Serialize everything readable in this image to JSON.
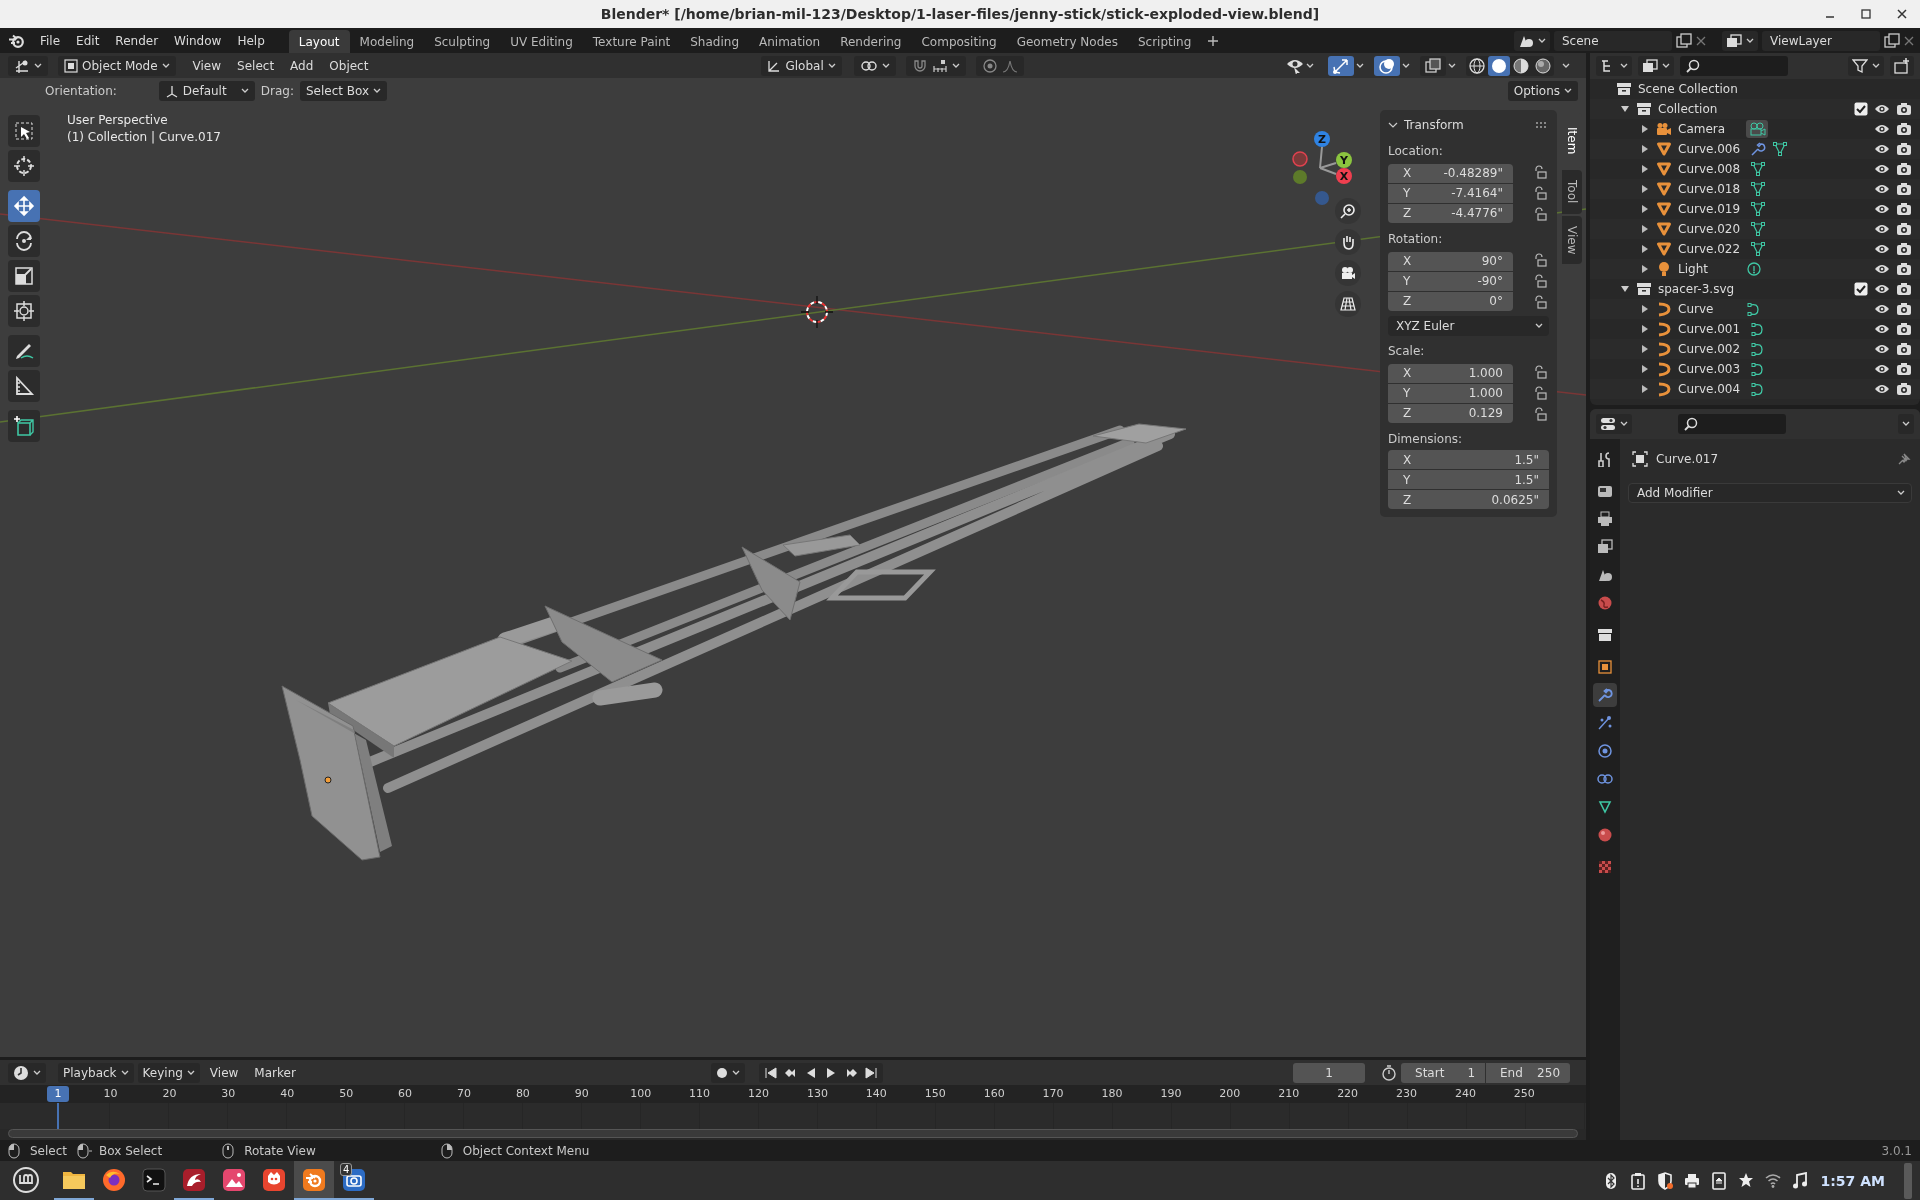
{
  "window": {
    "title": "Blender* [/home/brian-mil-123/Desktop/1-laser-files/jenny-stick/stick-exploded-view.blend]"
  },
  "menu": [
    "File",
    "Edit",
    "Render",
    "Window",
    "Help"
  ],
  "workspaces": [
    {
      "label": "Layout",
      "selected": true
    },
    {
      "label": "Modeling",
      "selected": false
    },
    {
      "label": "Sculpting",
      "selected": false
    },
    {
      "label": "UV Editing",
      "selected": false
    },
    {
      "label": "Texture Paint",
      "selected": false
    },
    {
      "label": "Shading",
      "selected": false
    },
    {
      "label": "Animation",
      "selected": false
    },
    {
      "label": "Rendering",
      "selected": false
    },
    {
      "label": "Compositing",
      "selected": false
    },
    {
      "label": "Geometry Nodes",
      "selected": false
    },
    {
      "label": "Scripting",
      "selected": false
    }
  ],
  "scene": "Scene",
  "view_layer": "ViewLayer",
  "viewport": {
    "mode": "Object Mode",
    "menus": [
      "View",
      "Select",
      "Add",
      "Object"
    ],
    "orientation_global": "Global",
    "toggles": [
      {
        "kind": "gizmos",
        "on": true
      },
      {
        "kind": "overlays",
        "on": true
      },
      {
        "kind": "xray",
        "on": false
      }
    ],
    "shading": [
      {
        "kind": "wireframe",
        "selected": false
      },
      {
        "kind": "solid",
        "selected": true
      },
      {
        "kind": "material",
        "selected": false
      },
      {
        "kind": "rendered",
        "selected": false
      }
    ],
    "tool_settings": {
      "orientation_label": "Orientation:",
      "orientation": "Default",
      "drag_label": "Drag:",
      "drag": "Select Box",
      "options": "Options"
    },
    "tool_groups": [
      [
        {
          "kind": "select_box",
          "selected": false
        },
        {
          "kind": "cursor",
          "selected": false
        }
      ],
      [
        {
          "kind": "move",
          "selected": true
        },
        {
          "kind": "rotate",
          "selected": false
        },
        {
          "kind": "scale",
          "selected": false
        },
        {
          "kind": "transform",
          "selected": false
        }
      ],
      [
        {
          "kind": "annotate",
          "selected": false
        },
        {
          "kind": "measure",
          "selected": false
        }
      ],
      [
        {
          "kind": "add_cube",
          "selected": false
        }
      ]
    ],
    "overlay_text": [
      "User Perspective",
      "(1) Collection | Curve.017"
    ],
    "gizmo_axes": [
      "Z",
      "Y",
      "X"
    ],
    "sidebar": {
      "tabs": [
        {
          "label": "Item",
          "selected": true
        },
        {
          "label": "Tool",
          "selected": false
        },
        {
          "label": "View",
          "selected": false
        }
      ],
      "panel": {
        "title": "Transform",
        "groups": [
          {
            "kind": "vector",
            "label": "Location:",
            "locks": true,
            "fields": [
              {
                "axis": "X",
                "value": "-0.48289\""
              },
              {
                "axis": "Y",
                "value": "-7.4164\""
              },
              {
                "axis": "Z",
                "value": "-4.4776\""
              }
            ]
          },
          {
            "kind": "vector",
            "label": "Rotation:",
            "locks": true,
            "fields": [
              {
                "axis": "X",
                "value": "90°"
              },
              {
                "axis": "Y",
                "value": "-90°"
              },
              {
                "axis": "Z",
                "value": "0°"
              }
            ]
          },
          {
            "kind": "dropdown",
            "value": "XYZ Euler"
          },
          {
            "kind": "vector",
            "label": "Scale:",
            "locks": true,
            "fields": [
              {
                "axis": "X",
                "value": "1.000"
              },
              {
                "axis": "Y",
                "value": "1.000"
              },
              {
                "axis": "Z",
                "value": "0.129"
              }
            ]
          },
          {
            "kind": "vector",
            "label": "Dimensions:",
            "locks": false,
            "fields": [
              {
                "axis": "X",
                "value": "1.5\""
              },
              {
                "axis": "Y",
                "value": "1.5\""
              },
              {
                "axis": "Z",
                "value": "0.0625\""
              }
            ]
          }
        ]
      }
    }
  },
  "outliner": {
    "tree": {
      "name": "Scene Collection",
      "children": [
        {
          "name": "Collection",
          "kind": "collection",
          "expanded": true,
          "checked": true,
          "children": [
            {
              "name": "Camera",
              "kind": "camera",
              "expanded": false,
              "modifier": false
            },
            {
              "name": "Curve.006",
              "kind": "mesh",
              "expanded": false,
              "modifier": true
            },
            {
              "name": "Curve.008",
              "kind": "mesh",
              "expanded": false,
              "modifier": false
            },
            {
              "name": "Curve.018",
              "kind": "mesh",
              "expanded": false,
              "modifier": false
            },
            {
              "name": "Curve.019",
              "kind": "mesh",
              "expanded": false,
              "modifier": false
            },
            {
              "name": "Curve.020",
              "kind": "mesh",
              "expanded": false,
              "modifier": false
            },
            {
              "name": "Curve.022",
              "kind": "mesh",
              "expanded": false,
              "modifier": false
            },
            {
              "name": "Light",
              "kind": "light",
              "expanded": false,
              "modifier": false
            }
          ]
        },
        {
          "name": "spacer-3.svg",
          "kind": "collection",
          "expanded": true,
          "checked": true,
          "children": [
            {
              "name": "Curve",
              "kind": "curve",
              "expanded": false,
              "modifier": false
            },
            {
              "name": "Curve.001",
              "kind": "curve",
              "expanded": false,
              "modifier": false
            },
            {
              "name": "Curve.002",
              "kind": "curve",
              "expanded": false,
              "modifier": false
            },
            {
              "name": "Curve.003",
              "kind": "curve",
              "expanded": false,
              "modifier": false
            },
            {
              "name": "Curve.004",
              "kind": "curve",
              "expanded": false,
              "modifier": false
            }
          ]
        }
      ]
    }
  },
  "properties": {
    "object": "Curve.017",
    "add_modifier": "Add Modifier",
    "tab_groups": [
      [
        {
          "kind": "tool",
          "selected": false
        }
      ],
      [
        {
          "kind": "render",
          "selected": false
        },
        {
          "kind": "output",
          "selected": false
        },
        {
          "kind": "view_layer",
          "selected": false
        },
        {
          "kind": "scene",
          "selected": false
        },
        {
          "kind": "world",
          "selected": false
        }
      ],
      [
        {
          "kind": "collection",
          "selected": false
        }
      ],
      [
        {
          "kind": "object",
          "selected": false
        },
        {
          "kind": "modifiers",
          "selected": true
        },
        {
          "kind": "particles",
          "selected": false
        },
        {
          "kind": "physics",
          "selected": false
        },
        {
          "kind": "constraints",
          "selected": false
        },
        {
          "kind": "data",
          "selected": false
        },
        {
          "kind": "material",
          "selected": false
        }
      ],
      [
        {
          "kind": "texture",
          "selected": false
        }
      ]
    ]
  },
  "timeline": {
    "menus": [
      {
        "label": "Playback",
        "dropdown": true
      },
      {
        "label": "Keying",
        "dropdown": true
      },
      {
        "label": "View",
        "dropdown": false
      },
      {
        "label": "Marker",
        "dropdown": false
      }
    ],
    "current_frame": "1",
    "start_label": "Start",
    "start": "1",
    "end_label": "End",
    "end": "250",
    "playhead": "1",
    "ruler": [
      "10",
      "20",
      "30",
      "40",
      "50",
      "60",
      "70",
      "80",
      "90",
      "100",
      "110",
      "120",
      "130",
      "140",
      "150",
      "160",
      "170",
      "180",
      "190",
      "200",
      "210",
      "220",
      "230",
      "240",
      "250"
    ]
  },
  "status_bar": {
    "hints": [
      {
        "kind": "left",
        "label": "Select"
      },
      {
        "kind": "drag",
        "label": "Box Select"
      },
      {
        "kind": "middle",
        "label": "Rotate View"
      },
      {
        "kind": "right",
        "label": "Object Context Menu"
      }
    ],
    "version": "3.0.1"
  },
  "taskbar": {
    "apps": [
      {
        "kind": "files",
        "running": true,
        "active": false
      },
      {
        "kind": "browser",
        "running": false,
        "active": false
      },
      {
        "kind": "terminal",
        "running": false,
        "active": false
      },
      {
        "kind": "dragon",
        "running": true,
        "active": false
      },
      {
        "kind": "images",
        "running": false,
        "active": false
      },
      {
        "kind": "paint",
        "running": false,
        "active": false
      },
      {
        "kind": "blender",
        "running": true,
        "active": true
      },
      {
        "kind": "screenshot",
        "running": true,
        "active": false,
        "badge": "4"
      }
    ],
    "clock": "1:57 AM"
  }
}
